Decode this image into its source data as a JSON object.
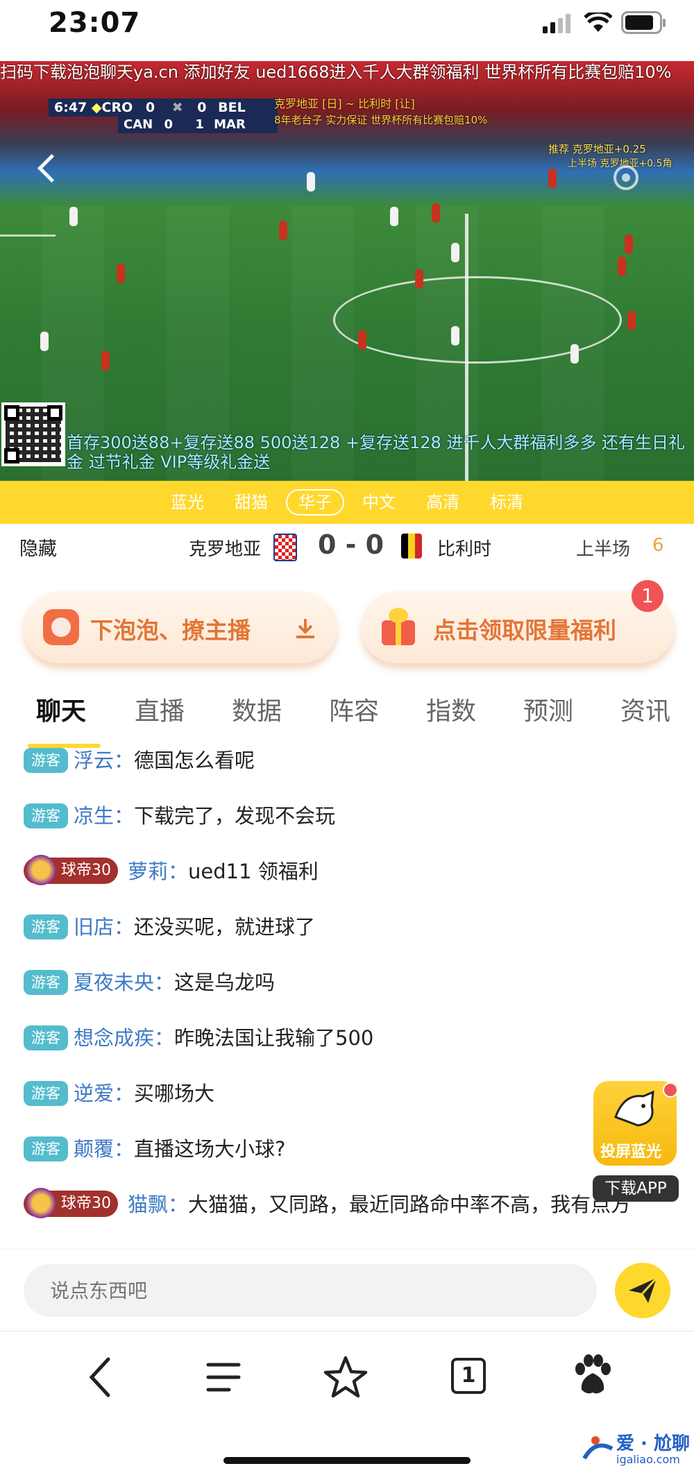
{
  "status_bar": {
    "time": "23:07"
  },
  "video": {
    "banner_top": "扫码下载泡泡聊天ya.cn 添加好友 ued1668进入千人大群领福利 世界杯所有比赛包赔10%",
    "scoreboard": {
      "clock": "6:47",
      "home": "CRO",
      "home_score": "0",
      "away_score": "0",
      "away": "BEL"
    },
    "scoreboard2": {
      "home": "CAN",
      "home_score": "0",
      "away_score": "1",
      "away": "MAR"
    },
    "promo_line_1": "克罗地亚 [日] ~ 比利时 [让]",
    "promo_line_2": "8年老台子 实力保证 世界杯所有比赛包赔10%",
    "recommend_1": "推荐  克罗地亚+0.25",
    "recommend_2": "上半场 克罗地亚+0.5角",
    "bottom_promo": "首存300送88+复存送88 500送128 +复存送128 进千人大群福利多多 还有生日礼金 过节礼金 VIP等级礼金送"
  },
  "sources": [
    {
      "label": "蓝光"
    },
    {
      "label": "甜猫"
    },
    {
      "label": "华子",
      "active": true
    },
    {
      "label": "中文"
    },
    {
      "label": "高清"
    },
    {
      "label": "标清"
    }
  ],
  "match": {
    "hide": "隐藏",
    "home_team": "克罗地亚",
    "score": "0 - 0",
    "away_team": "比利时",
    "period": "上半场",
    "minute": "6"
  },
  "buttons": {
    "download": "下泡泡、撩主播",
    "welfare": "点击领取限量福利",
    "welfare_badge": "1"
  },
  "tabs": [
    {
      "label": "聊天",
      "active": true
    },
    {
      "label": "直播"
    },
    {
      "label": "数据"
    },
    {
      "label": "阵容"
    },
    {
      "label": "指数"
    },
    {
      "label": "预测"
    },
    {
      "label": "资讯"
    }
  ],
  "chat": [
    {
      "tag": "游客",
      "type": "guest",
      "user": "浮云",
      "msg": "德国怎么看呢"
    },
    {
      "tag": "游客",
      "type": "guest",
      "user": "凉生",
      "msg": "下载完了，发现不会玩"
    },
    {
      "tag": "球帝30",
      "type": "vip",
      "user": "萝莉",
      "msg": "ued11 领福利"
    },
    {
      "tag": "游客",
      "type": "guest",
      "user": "旧店",
      "msg": "还没买呢，就进球了"
    },
    {
      "tag": "游客",
      "type": "guest",
      "user": "夏夜未央",
      "msg": "这是乌龙吗"
    },
    {
      "tag": "游客",
      "type": "guest",
      "user": "想念成疾",
      "msg": "昨晚法国让我输了500"
    },
    {
      "tag": "游客",
      "type": "guest",
      "user": "逆爱",
      "msg": "买哪场大"
    },
    {
      "tag": "游客",
      "type": "guest",
      "user": "颠覆",
      "msg": "直播这场大小球?"
    },
    {
      "tag": "球帝30",
      "type": "vip",
      "user": "猫飘",
      "msg": "大猫猫，又同路，最近同路命中率不高，我有点方"
    }
  ],
  "floating": {
    "label": "投屏蓝光",
    "download": "下载APP"
  },
  "input": {
    "placeholder": "说点东西吧"
  },
  "browser": {
    "tab_count": "1"
  },
  "watermark": {
    "title": "爱 · 尬聊",
    "sub": "igaliao.com"
  }
}
